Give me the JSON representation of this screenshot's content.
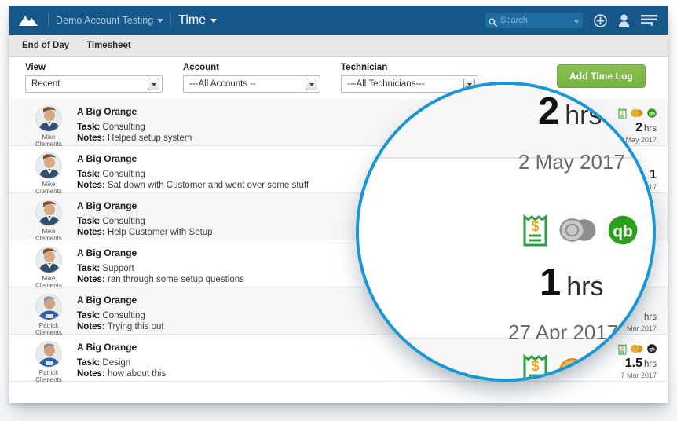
{
  "topnav": {
    "logo_icon": "mountain-logo-icon",
    "account_label": "Demo Account Testing",
    "section_title": "Time",
    "search_placeholder": "Search",
    "search_value": "",
    "search_icon": "search-icon",
    "add_icon": "plus-circle-icon",
    "user_icon": "user-icon",
    "menu_icon": "hamburger-menu-icon"
  },
  "subnav": {
    "tabs": [
      {
        "label": "End of Day"
      },
      {
        "label": "Timesheet"
      }
    ]
  },
  "filters": {
    "view": {
      "label": "View",
      "value": "Recent"
    },
    "account": {
      "label": "Account",
      "value": "---All Accounts --"
    },
    "technician": {
      "label": "Technician",
      "value": "---All Technicians---"
    },
    "add_button_label": "Add Time Log"
  },
  "labels": {
    "task": "Task:",
    "notes": "Notes:",
    "hours_unit": "hrs"
  },
  "rows": [
    {
      "technician": "Mike Clements",
      "technician_first": "Mike",
      "technician_last": "Clements",
      "account": "A Big Orange",
      "task": "Consulting",
      "notes": "Helped setup system",
      "hours": "2",
      "date": "2 May 2017",
      "badges": [
        "receipt-icon",
        "gold-coins-icon",
        "quickbooks-icon"
      ]
    },
    {
      "technician": "Mike Clements",
      "technician_first": "Mike",
      "technician_last": "Clements",
      "account": "A Big Orange",
      "task": "Consulting",
      "notes": "Sat down with Customer and went over some stuff",
      "hours": "1",
      "date": "27 Apr 2017",
      "badges": [
        "receipt-icon",
        "silver-coins-icon",
        "quickbooks-icon"
      ]
    },
    {
      "technician": "Mike Clements",
      "technician_first": "Mike",
      "technician_last": "Clements",
      "account": "A Big Orange",
      "task": "Consulting",
      "notes": "Help Customer with Setup",
      "hours": "",
      "date": "",
      "badges": [
        "receipt-icon",
        "gold-coins-icon",
        "dark-coins-icon"
      ]
    },
    {
      "technician": "Mike Clements",
      "technician_first": "Mike",
      "technician_last": "Clements",
      "account": "A Big Orange",
      "task": "Support",
      "notes": "ran through some setup questions",
      "hours": "",
      "date": "",
      "badges": []
    },
    {
      "technician": "Patrick Clements",
      "technician_first": "Patrick",
      "technician_last": "Clements",
      "account": "A Big Orange",
      "task": "Consulting",
      "notes": "Trying this out",
      "hours": "",
      "date": "Mar 2017",
      "badges": []
    },
    {
      "technician": "Patrick Clements",
      "technician_first": "Patrick",
      "technician_last": "Clements",
      "account": "A Big Orange",
      "task": "Design",
      "notes": "how about this",
      "hours": "1.5",
      "date": "7 Mar 2017",
      "badges": [
        "receipt-icon",
        "gold-coins-icon",
        "quickbooks-dark-icon"
      ]
    }
  ],
  "magnifier": {
    "border_color": "#1b96d5",
    "entries": [
      {
        "hours": "2",
        "unit": "hrs",
        "date": "2 May 2017",
        "badges": [
          "receipt-icon",
          "gold-coins-icon"
        ]
      },
      {
        "hours": "1",
        "unit": "hrs",
        "date": "27 Apr 2017",
        "badges": [
          "receipt-icon",
          "silver-coins-icon",
          "quickbooks-icon"
        ]
      },
      {
        "hours": "",
        "unit": "",
        "date": "",
        "badges": [
          "receipt-icon",
          "gold-coins-icon",
          "dark-coins-icon"
        ]
      }
    ]
  },
  "colors": {
    "nav_blue": "#165788",
    "accent_green": "#7db844",
    "magnifier_blue": "#1b96d5",
    "quickbooks_green": "#2ca01c"
  }
}
